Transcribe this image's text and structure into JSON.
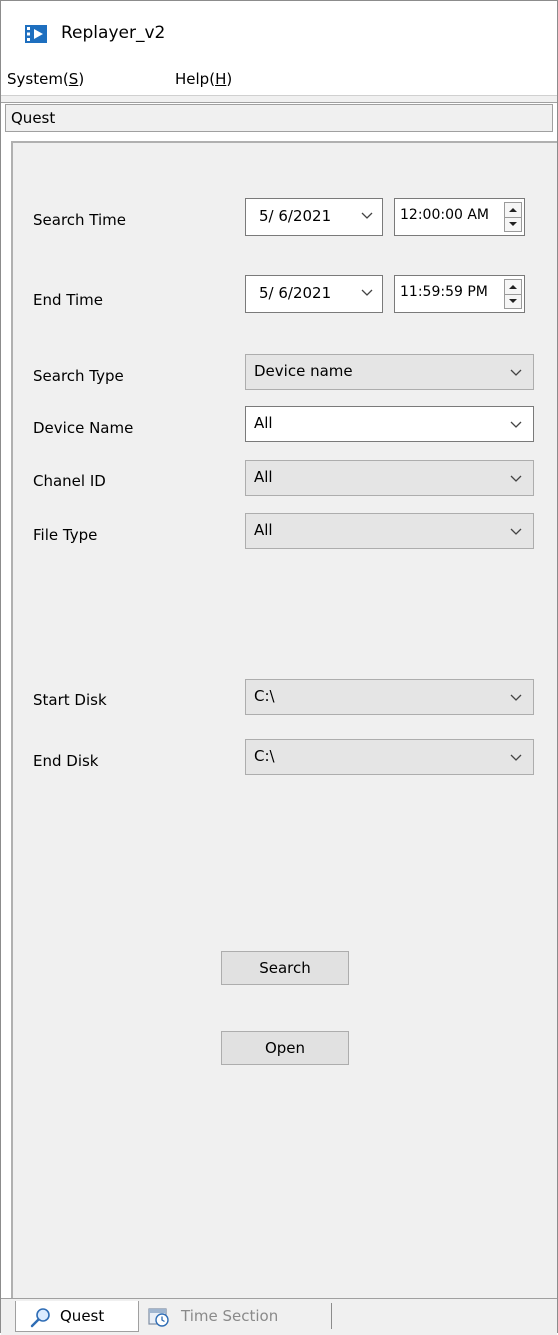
{
  "window": {
    "title": "Replayer_v2"
  },
  "menu": {
    "items": [
      {
        "label": "System(",
        "accel": "S",
        "close": ")"
      },
      {
        "label": "Help(",
        "accel": "H",
        "close": ")"
      }
    ]
  },
  "section": {
    "title": "Quest"
  },
  "form": {
    "search_time": {
      "label": "Search Time",
      "date": "5/ 6/2021",
      "time": "12:00:00 AM"
    },
    "end_time": {
      "label": "End Time",
      "date": "5/ 6/2021",
      "time": "11:59:59 PM"
    },
    "search_type": {
      "label": "Search Type",
      "value": "Device name"
    },
    "device_name": {
      "label": "Device Name",
      "value": "All"
    },
    "chanel_id": {
      "label": "Chanel ID",
      "value": "All"
    },
    "file_type": {
      "label": "File Type",
      "value": "All"
    },
    "start_disk": {
      "label": "Start Disk",
      "value": "C:\\"
    },
    "end_disk": {
      "label": "End Disk",
      "value": "C:\\"
    }
  },
  "buttons": {
    "search": "Search",
    "open": "Open"
  },
  "tabs": [
    {
      "label": "Quest",
      "icon": "magnifier-icon",
      "active": true
    },
    {
      "label": "Time Section",
      "icon": "clock-icon",
      "active": false
    }
  ],
  "colors": {
    "panel_bg": "#f0f0f0",
    "combo_bg": "#e5e5e5",
    "button_bg": "#e1e1e1",
    "icon_blue": "#1e6fbf"
  }
}
